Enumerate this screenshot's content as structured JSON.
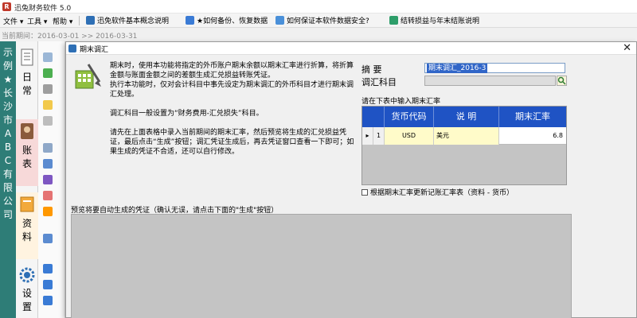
{
  "app": {
    "title": "迅兔财务软件 5.0",
    "logo_char": "R"
  },
  "menubar": {
    "items": [
      "文件",
      "工具",
      "帮助"
    ],
    "quick_links": [
      {
        "label": "迅免软件基本概念说明",
        "icon": "info-icon"
      },
      {
        "label": "★如何备份、恢复数据",
        "icon": "backup-icon"
      },
      {
        "label": "如何保证本软件数据安全?",
        "icon": "shield-icon"
      },
      {
        "label": "结转损益与年末结账说明",
        "icon": "ledger-icon"
      }
    ]
  },
  "date_range": "当前期间：2016-03-01 >> 2016-03-31",
  "company": "示例★长沙市ABC有限公司",
  "nav": [
    {
      "label": "日常",
      "icon": "document-icon"
    },
    {
      "label": "账表",
      "icon": "person-book-icon"
    },
    {
      "label": "资料",
      "icon": "folder-icon"
    },
    {
      "label": "设置",
      "icon": "gear-icon"
    }
  ],
  "dialog": {
    "title": "期末调汇",
    "close_glyph": "✕",
    "description": [
      "期末时，使用本功能将指定的外币账户期末余额以期末汇率进行折算，将折算金额与账面金额之间的差额生成汇兑损益转账凭证。",
      "执行本功能时，仅对会计科目中事先设定为期末调汇的外币科目才进行期末调汇处理。",
      "",
      "调汇科目一般设置为“财务费用-汇兑损失”科目。",
      "",
      "请先在上面表格中录入当前期间的期末汇率，然后预览将生成的汇兑损益凭证，最后点击“生成”按钮；调汇凭证生成后，再去凭证窗口查看一下即可；如果生成的凭证不合适，还可以自行修改。"
    ],
    "preview_label": "预览将要自动生成的凭证（确认无误，请点击下面的\"生成\"按钮）",
    "form": {
      "summary_label": "摘  要",
      "summary_value": "期末调汇_2016-3",
      "account_label": "调汇科目",
      "account_value": "",
      "rate_prompt": "请在下表中输入期末汇率",
      "grid": {
        "headers": [
          "货币代码",
          "说  明",
          "期末汇率"
        ],
        "rows": [
          {
            "indicator": "▸",
            "index": "1",
            "code": "USD",
            "desc": "美元",
            "rate": "6.8"
          }
        ]
      },
      "update_checkbox_label": "根据期末汇率更新记账汇率表（资料 - 货币）",
      "update_checkbox_checked": false
    }
  },
  "colors": {
    "teal": "#2e7d77",
    "grid_header": "#1f53c4",
    "preview_bg": "#c4c4c4",
    "selected_text_bg": "#3166c8"
  }
}
